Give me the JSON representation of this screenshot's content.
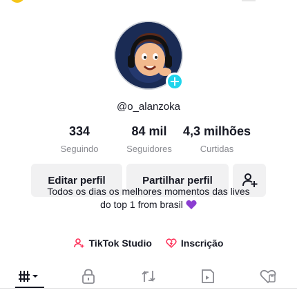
{
  "profile": {
    "username": "@o_alanzoka"
  },
  "stats": [
    {
      "value": "334",
      "label": "Seguindo"
    },
    {
      "value": "84 mil",
      "label": "Seguidores"
    },
    {
      "value": "4,3 milhões",
      "label": "Curtidas"
    }
  ],
  "actions": {
    "edit_label": "Editar perfil",
    "share_label": "Partilhar perfil",
    "add_friends_icon": "add-person-icon"
  },
  "bio": {
    "line1": "Todos os dias os melhores momentos das lives",
    "line2": "do top 1 from brasil",
    "emoji": "purple-heart"
  },
  "links": {
    "studio_label": "TikTok Studio",
    "subscription_label": "Inscrição"
  },
  "tabs": [
    {
      "icon": "videos-grid-icon",
      "active": true
    },
    {
      "icon": "lock-icon",
      "active": false
    },
    {
      "icon": "repost-icon",
      "active": false
    },
    {
      "icon": "bookmark-icon",
      "active": false
    },
    {
      "icon": "liked-heart-icon",
      "active": false
    }
  ],
  "colors": {
    "accent_cyan": "#20d5ec",
    "accent_pink": "#fe2c55",
    "heart_purple": "#8b3dd1",
    "text_primary": "#161823",
    "text_secondary": "#8a8b91"
  }
}
